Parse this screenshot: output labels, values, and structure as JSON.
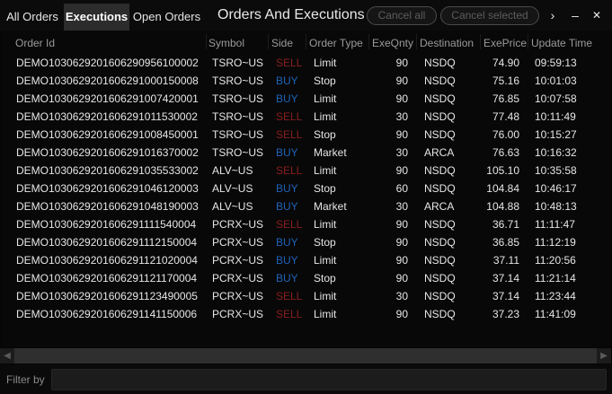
{
  "tabs": [
    {
      "label": "All Orders",
      "active": false
    },
    {
      "label": "Executions",
      "active": true
    },
    {
      "label": "Open Orders",
      "active": false
    }
  ],
  "window": {
    "title": "Orders And Executions",
    "cancel_all_label": "Cancel all",
    "cancel_selected_label": "Cancel selected",
    "more_glyph": "›",
    "minimize_glyph": "–",
    "close_glyph": "✕"
  },
  "table": {
    "columns": [
      "Order Id",
      "Symbol",
      "Side",
      "Order Type",
      "ExeQnty",
      "Destination",
      "ExePrice",
      "Update Time"
    ],
    "rows": [
      [
        "DEMO1030629201606290956100002",
        "TSRO~US",
        "SELL",
        "Limit",
        "90",
        "NSDQ",
        "74.90",
        "09:59:13"
      ],
      [
        "DEMO1030629201606291000150008",
        "TSRO~US",
        "BUY",
        "Stop",
        "90",
        "NSDQ",
        "75.16",
        "10:01:03"
      ],
      [
        "DEMO1030629201606291007420001",
        "TSRO~US",
        "BUY",
        "Limit",
        "90",
        "NSDQ",
        "76.85",
        "10:07:58"
      ],
      [
        "DEMO1030629201606291011530002",
        "TSRO~US",
        "SELL",
        "Limit",
        "30",
        "NSDQ",
        "77.48",
        "10:11:49"
      ],
      [
        "DEMO1030629201606291008450001",
        "TSRO~US",
        "SELL",
        "Stop",
        "90",
        "NSDQ",
        "76.00",
        "10:15:27"
      ],
      [
        "DEMO1030629201606291016370002",
        "TSRO~US",
        "BUY",
        "Market",
        "30",
        "ARCA",
        "76.63",
        "10:16:32"
      ],
      [
        "DEMO1030629201606291035533002",
        "ALV~US",
        "SELL",
        "Limit",
        "90",
        "NSDQ",
        "105.10",
        "10:35:58"
      ],
      [
        "DEMO1030629201606291046120003",
        "ALV~US",
        "BUY",
        "Stop",
        "60",
        "NSDQ",
        "104.84",
        "10:46:17"
      ],
      [
        "DEMO1030629201606291048190003",
        "ALV~US",
        "BUY",
        "Market",
        "30",
        "ARCA",
        "104.88",
        "10:48:13"
      ],
      [
        "DEMO1030629201606291111540004",
        "PCRX~US",
        "SELL",
        "Limit",
        "90",
        "NSDQ",
        "36.71",
        "11:11:47"
      ],
      [
        "DEMO1030629201606291112150004",
        "PCRX~US",
        "BUY",
        "Stop",
        "90",
        "NSDQ",
        "36.85",
        "11:12:19"
      ],
      [
        "DEMO1030629201606291121020004",
        "PCRX~US",
        "BUY",
        "Limit",
        "90",
        "NSDQ",
        "37.11",
        "11:20:56"
      ],
      [
        "DEMO1030629201606291121170004",
        "PCRX~US",
        "BUY",
        "Stop",
        "90",
        "NSDQ",
        "37.14",
        "11:21:14"
      ],
      [
        "DEMO1030629201606291123490005",
        "PCRX~US",
        "SELL",
        "Limit",
        "30",
        "NSDQ",
        "37.14",
        "11:23:44"
      ],
      [
        "DEMO1030629201606291141150006",
        "PCRX~US",
        "SELL",
        "Limit",
        "90",
        "NSDQ",
        "37.23",
        "11:41:09"
      ]
    ]
  },
  "filter": {
    "label": "Filter by",
    "value": ""
  },
  "scroll": {
    "left_glyph": "◀",
    "right_glyph": "▶"
  },
  "colors": {
    "sell": "#8a1e1e",
    "buy": "#1f63b8",
    "active_tab": "#2c2c2c",
    "background": "#050505"
  }
}
